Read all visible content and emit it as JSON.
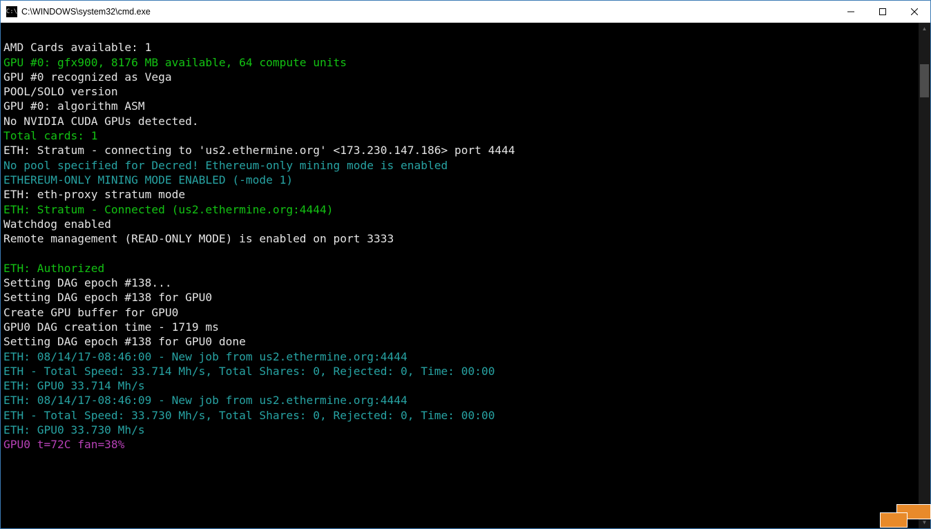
{
  "window": {
    "title": "C:\\WINDOWS\\system32\\cmd.exe",
    "icon_label": "C:\\"
  },
  "lines": [
    {
      "text": "",
      "color": "c-white"
    },
    {
      "text": "AMD Cards available: 1",
      "color": "c-white"
    },
    {
      "text": "GPU #0: gfx900, 8176 MB available, 64 compute units",
      "color": "c-green"
    },
    {
      "text": "GPU #0 recognized as Vega",
      "color": "c-white"
    },
    {
      "text": "POOL/SOLO version",
      "color": "c-white"
    },
    {
      "text": "GPU #0: algorithm ASM",
      "color": "c-white"
    },
    {
      "text": "No NVIDIA CUDA GPUs detected.",
      "color": "c-white"
    },
    {
      "text": "Total cards: 1",
      "color": "c-green"
    },
    {
      "text": "ETH: Stratum - connecting to 'us2.ethermine.org' <173.230.147.186> port 4444",
      "color": "c-white"
    },
    {
      "text": "No pool specified for Decred! Ethereum-only mining mode is enabled",
      "color": "c-cyan"
    },
    {
      "text": "ETHEREUM-ONLY MINING MODE ENABLED (-mode 1)",
      "color": "c-cyan"
    },
    {
      "text": "ETH: eth-proxy stratum mode",
      "color": "c-white"
    },
    {
      "text": "ETH: Stratum - Connected (us2.ethermine.org:4444)",
      "color": "c-green"
    },
    {
      "text": "Watchdog enabled",
      "color": "c-white"
    },
    {
      "text": "Remote management (READ-ONLY MODE) is enabled on port 3333",
      "color": "c-white"
    },
    {
      "text": "",
      "color": "c-white"
    },
    {
      "text": "ETH: Authorized",
      "color": "c-green"
    },
    {
      "text": "Setting DAG epoch #138...",
      "color": "c-white"
    },
    {
      "text": "Setting DAG epoch #138 for GPU0",
      "color": "c-white"
    },
    {
      "text": "Create GPU buffer for GPU0",
      "color": "c-white"
    },
    {
      "text": "GPU0 DAG creation time - 1719 ms",
      "color": "c-white"
    },
    {
      "text": "Setting DAG epoch #138 for GPU0 done",
      "color": "c-white"
    },
    {
      "text": "ETH: 08/14/17-08:46:00 - New job from us2.ethermine.org:4444",
      "color": "c-cyan"
    },
    {
      "text": "ETH - Total Speed: 33.714 Mh/s, Total Shares: 0, Rejected: 0, Time: 00:00",
      "color": "c-cyan"
    },
    {
      "text": "ETH: GPU0 33.714 Mh/s",
      "color": "c-cyan"
    },
    {
      "text": "ETH: 08/14/17-08:46:09 - New job from us2.ethermine.org:4444",
      "color": "c-cyan"
    },
    {
      "text": "ETH - Total Speed: 33.730 Mh/s, Total Shares: 0, Rejected: 0, Time: 00:00",
      "color": "c-cyan"
    },
    {
      "text": "ETH: GPU0 33.730 Mh/s",
      "color": "c-cyan"
    },
    {
      "text": "GPU0 t=72C fan=38%",
      "color": "c-purple"
    }
  ]
}
